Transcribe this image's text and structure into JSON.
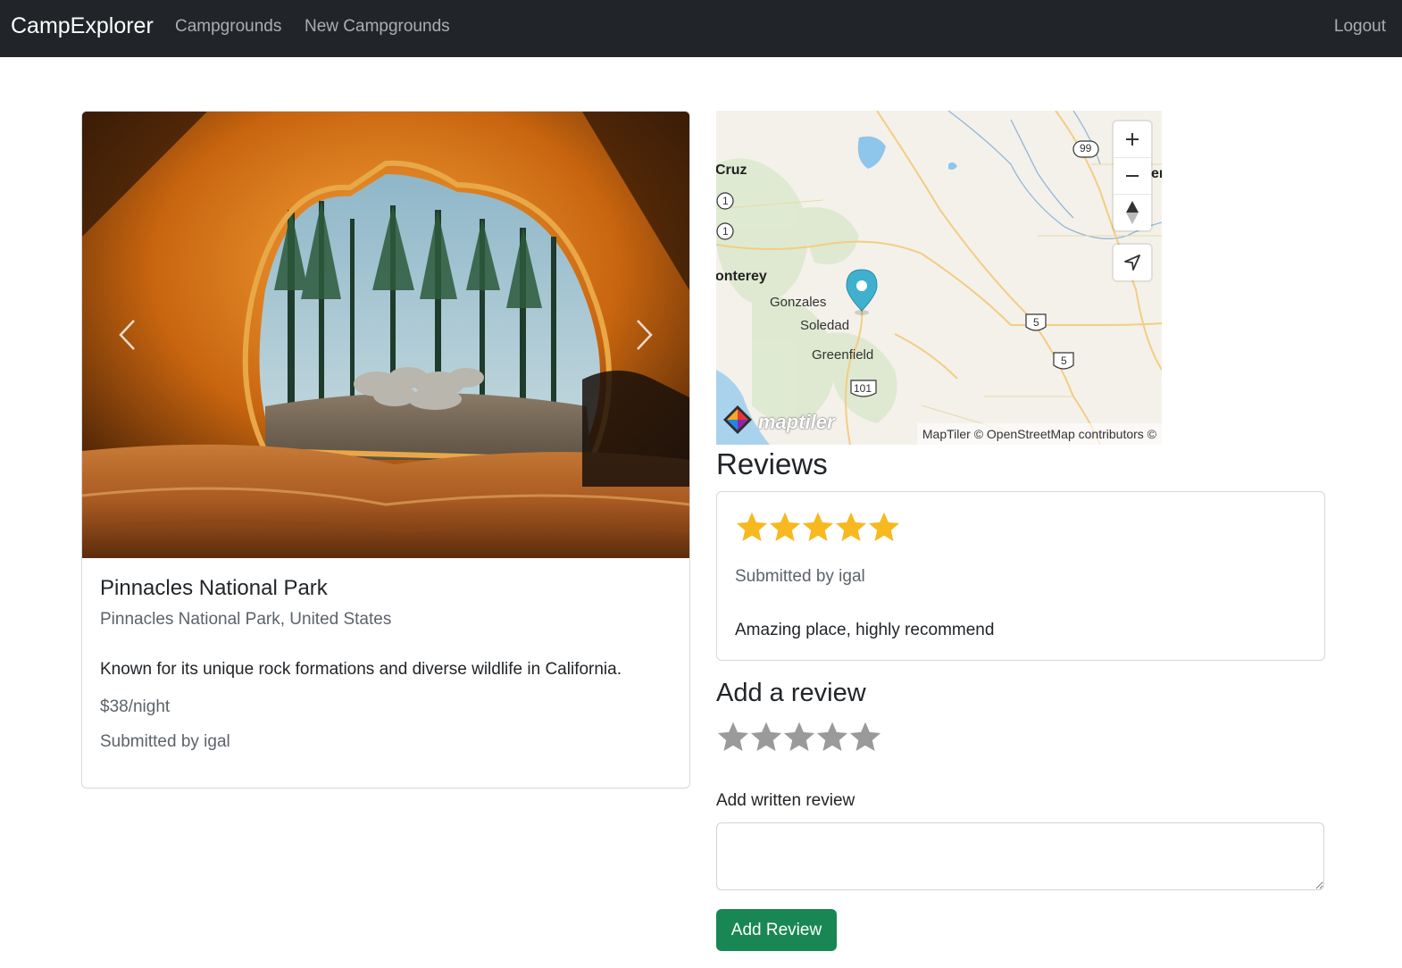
{
  "navbar": {
    "brand": "CampExplorer",
    "links": {
      "campgrounds": "Campgrounds",
      "new_campgrounds": "New Campgrounds",
      "logout": "Logout"
    }
  },
  "campground": {
    "title": "Pinnacles National Park",
    "location": "Pinnacles National Park, United States",
    "description": "Known for its unique rock formations and diverse wildlife in California.",
    "price": "$38/night",
    "submitted_by": "Submitted by igal",
    "carousel": {
      "prev_icon": "chevron-left-icon",
      "next_icon": "chevron-right-icon"
    }
  },
  "map": {
    "labels": {
      "cruz": "Cruz",
      "monterey": "onterey",
      "gonzales": "Gonzales",
      "soledad": "Soledad",
      "greenfield": "Greenfield",
      "er": "er"
    },
    "route_shields": {
      "r99": "99",
      "r1a": "1",
      "r1b": "1",
      "r5a": "5",
      "r5b": "5",
      "r101": "101"
    },
    "attribution": "MapTiler © OpenStreetMap contributors ©",
    "logo_text": "maptiler",
    "controls": [
      "zoom-in-icon",
      "zoom-out-icon",
      "compass-icon",
      "geolocate-icon"
    ],
    "marker_color": "#3fb1ce"
  },
  "reviews": {
    "heading": "Reviews",
    "items": [
      {
        "rating": 5,
        "author": "Submitted by igal",
        "body": "Amazing place, highly recommend"
      }
    ]
  },
  "add_review": {
    "heading": "Add a review",
    "rating": 0,
    "rating_max": 5,
    "written_label": "Add written review",
    "textarea_value": "",
    "submit_label": "Add Review"
  },
  "colors": {
    "navbar_bg": "#212529",
    "star_filled": "#f7b91f",
    "star_empty": "#9a9a9a",
    "button_success": "#198754"
  }
}
